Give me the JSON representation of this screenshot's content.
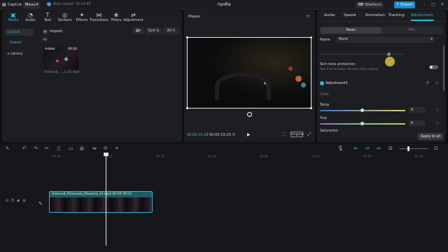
{
  "app": {
    "name": "CapCut",
    "menu": "Menu",
    "autosave": "Auto saved: 18:14:45",
    "project_title": "проба",
    "shortcut": "Shortcut",
    "export": "Export"
  },
  "toolbar_tabs": [
    {
      "label": "Media",
      "icon": "media-icon",
      "glyph": "▣"
    },
    {
      "label": "Audio",
      "icon": "audio-icon",
      "glyph": "◔"
    },
    {
      "label": "Text",
      "icon": "text-icon",
      "glyph": "T"
    },
    {
      "label": "Stickers",
      "icon": "stickers-icon",
      "glyph": "◎"
    },
    {
      "label": "Effects",
      "icon": "effects-icon",
      "glyph": "✦"
    },
    {
      "label": "Transitions",
      "icon": "transitions-icon",
      "glyph": "⋈"
    },
    {
      "label": "Filters",
      "icon": "filters-icon",
      "glyph": "❀"
    },
    {
      "label": "Adjustment",
      "icon": "adjustment-icon",
      "glyph": "⇄"
    }
  ],
  "media_side": {
    "local": "Local",
    "import": "Import",
    "library": "Library"
  },
  "media": {
    "import_label": "Import",
    "all_label": "All",
    "sort_label": "Sort",
    "filter_label": "All",
    "thumb_added": "Added",
    "thumb_duration": "00:20",
    "thumb_name": "Алексей_..._а_23.mp4"
  },
  "player": {
    "label": "Player",
    "time_current": "00:00:10:28",
    "time_total": "00:00:19:23",
    "original_label": "Original"
  },
  "right_tabs": [
    "Audio",
    "Speed",
    "Animation",
    "Tracking",
    "Adjustment"
  ],
  "adjust": {
    "basic_label": "Basic",
    "hsl_label": "HSL",
    "name_label": "Name",
    "name_value": "None",
    "skin_title": "Skin tone protection",
    "skin_desc": "Turn it on to make skin tone more natural",
    "section_title": "Adjustment1",
    "color_label": "Color",
    "temp_label": "Temp",
    "temp_value": "0",
    "hue_label": "Hue",
    "hue_value": "0",
    "saturation_label": "Saturation",
    "apply_label": "Apply to all"
  },
  "timeline": {
    "ruler": [
      "00:00",
      "00:10",
      "00:20",
      "00:30",
      "00:40",
      "00:50",
      "01:00",
      "01:10"
    ],
    "clip_label": "Алексей_Рязанцев_Машина_23.mp4   00:00:19:23"
  },
  "colors": {
    "accent": "#2fb7d6",
    "export_bg": "#1e88c8",
    "clip_bg": "#1a5d62",
    "panel_bg": "#1d1e21"
  }
}
